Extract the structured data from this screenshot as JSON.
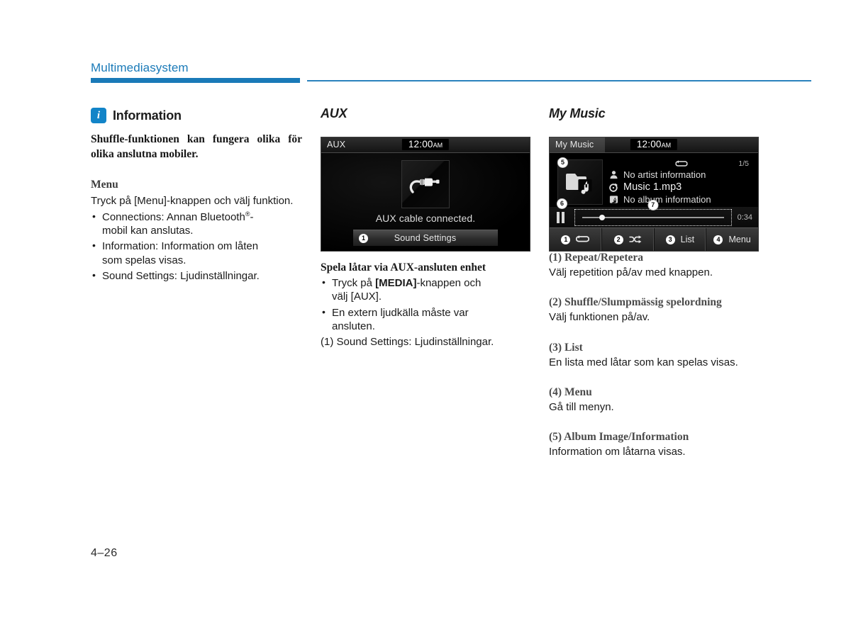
{
  "header": {
    "chapter_title": "Multimediasystem",
    "accent_color": "#1a7ab8"
  },
  "footer": {
    "page_number": "4–26"
  },
  "left_column": {
    "info_box": {
      "icon": "info-icon",
      "icon_letter": "i",
      "title": "Information",
      "body": "Shuffle-funktionen kan fungera olika för olika anslutna mobiler."
    },
    "menu_section": {
      "heading": "Menu",
      "intro": "Tryck på [Menu]-knappen och välj funktion.",
      "bullets": [
        {
          "line1": "Connections: Annan Bluetooth®-",
          "line2": "mobil kan anslutas."
        },
        {
          "line1": "Information: Information om låten",
          "line2": "som spelas visas."
        },
        {
          "line1": "Sound Settings: Ljudinställningar.",
          "line2": ""
        }
      ]
    }
  },
  "middle_column": {
    "section_title": "AUX",
    "screen": {
      "title": "AUX",
      "clock_time": "12:00",
      "clock_ampm": "AM",
      "art_icon": "aux-plug-icon",
      "caption": "AUX cable connected.",
      "sound_settings_button": {
        "number": "1",
        "label": "Sound Settings"
      }
    },
    "caption_heading": "Spela låtar via AUX-ansluten enhet",
    "bullets": [
      {
        "pre": "Tryck på ",
        "strong": "[MEDIA]",
        "post": "-knappen och",
        "line2": "välj [AUX]."
      },
      {
        "pre": "En extern ljudkälla måste var",
        "strong": "",
        "post": "",
        "line2": "ansluten."
      }
    ],
    "legend": "(1) Sound Settings: Ljudinställningar."
  },
  "right_column": {
    "section_title": "My Music",
    "screen": {
      "title": "My Music",
      "clock_time": "12:00",
      "clock_ampm": "AM",
      "album_art_badge": "5",
      "album_art_icon": "folder-music-icon",
      "repeat_icon": "repeat-icon",
      "track_count": "1/5",
      "rows": [
        {
          "icon": "artist-icon",
          "text": "No artist information"
        },
        {
          "icon": "disc-icon",
          "text": "Music 1.mp3"
        },
        {
          "icon": "album-icon",
          "text": "No album information"
        }
      ],
      "pause_badge": "6",
      "pause_icon": "pause-icon",
      "seek_badge": "7",
      "elapsed_time": "0:34",
      "softkeys": [
        {
          "number": "1",
          "icon": "repeat-icon",
          "label": ""
        },
        {
          "number": "2",
          "icon": "shuffle-icon",
          "label": ""
        },
        {
          "number": "3",
          "icon": "",
          "label": "List"
        },
        {
          "number": "4",
          "icon": "",
          "label": "Menu"
        }
      ]
    },
    "items": [
      {
        "heading": "(1) Repeat/Repetera",
        "body": "Välj repetition på/av med knappen."
      },
      {
        "heading": "(2) Shuffle/Slumpmässig spelordning",
        "body": "Välj funktionen på/av."
      },
      {
        "heading": "(3) List",
        "body": "En lista med låtar som kan spelas visas."
      },
      {
        "heading": "(4) Menu",
        "body": "Gå till menyn."
      },
      {
        "heading": "(5) Album Image/Information",
        "body": "Information om låtarna visas."
      }
    ]
  }
}
